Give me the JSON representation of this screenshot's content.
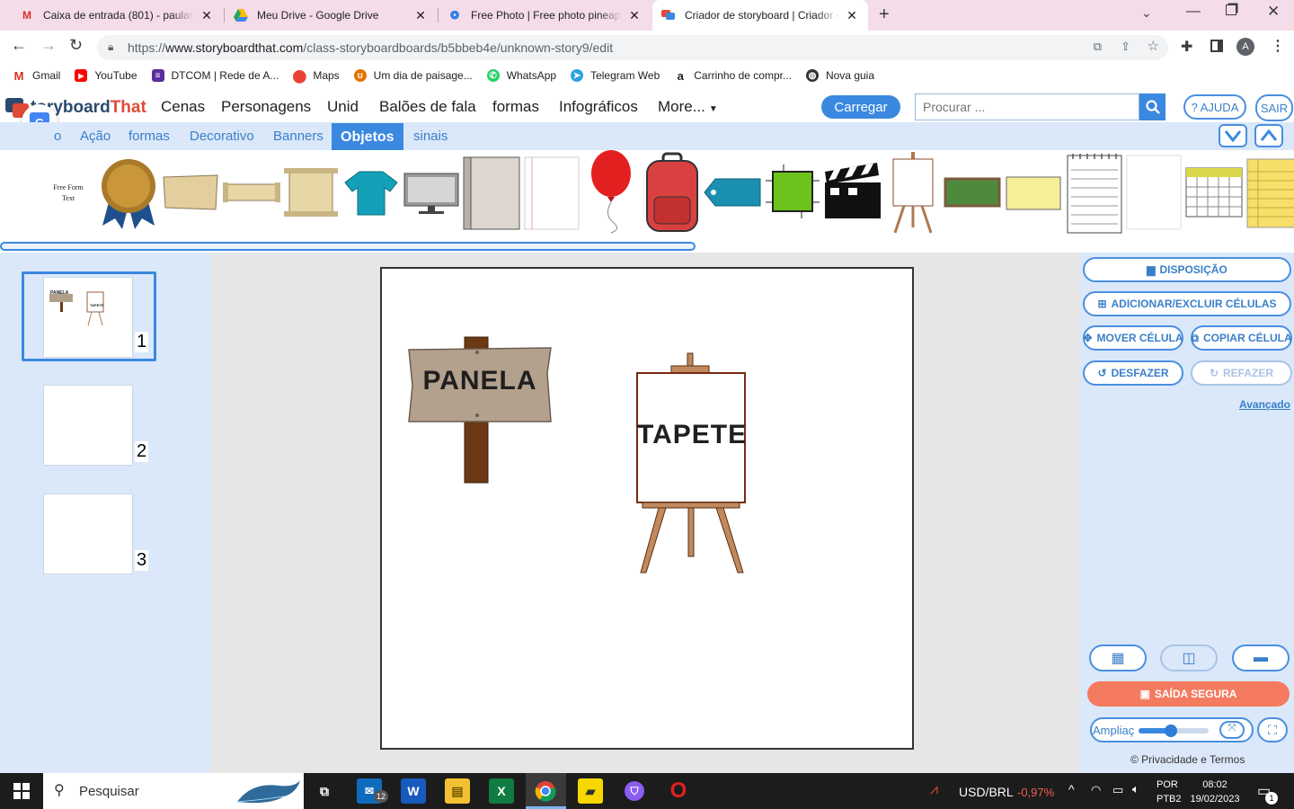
{
  "browser": {
    "tabs": [
      {
        "title": "Caixa de entrada (801) - paulario",
        "icon": "gmail-icon",
        "color": "#d93025"
      },
      {
        "title": "Meu Drive - Google Drive",
        "icon": "drive-icon",
        "color": "#1fa463"
      },
      {
        "title": "Free Photo | Free photo pineappl",
        "icon": "freepik-icon",
        "color": "#1273eb"
      },
      {
        "title": "Criador de storyboard | Criador d",
        "icon": "storyboardthat-icon",
        "color": "#e04b37"
      }
    ],
    "new_tab": "+",
    "url_prefix": "https://",
    "url_host": "www.storyboardthat.com",
    "url_path": "/class-storyboardboards/b5bbeb4e/unknown-story9/edit",
    "profile_initial": "A",
    "bookmarks": [
      {
        "label": "Gmail",
        "icon": "gmail-icon",
        "color": "#d93025"
      },
      {
        "label": "YouTube",
        "icon": "youtube-icon",
        "color": "#ff0000"
      },
      {
        "label": "DTCOM | Rede de A...",
        "icon": "dtcom-icon",
        "color": "#5b2c9e"
      },
      {
        "label": "Maps",
        "icon": "maps-icon",
        "color": "#34a853"
      },
      {
        "label": "Um dia de paisage...",
        "icon": "paisagem-icon",
        "color": "#e37400"
      },
      {
        "label": "WhatsApp",
        "icon": "whatsapp-icon",
        "color": "#25d366"
      },
      {
        "label": "Telegram Web",
        "icon": "telegram-icon",
        "color": "#2aa3e0"
      },
      {
        "label": "Carrinho de compr...",
        "icon": "amazon-icon",
        "color": "#222222"
      },
      {
        "label": "Nova guia",
        "icon": "globe-icon",
        "color": "#333333"
      }
    ]
  },
  "app": {
    "logo_main": "toryboard",
    "logo_accent": "That",
    "nav": [
      "Cenas",
      "Personagens",
      "Unid",
      "Balões de fala",
      "formas",
      "Infográficos",
      "More..."
    ],
    "upload": "Carregar",
    "search_placeholder": "Procurar ...",
    "help": "? AJUDA",
    "logout": "SAIR",
    "categories": [
      "o",
      "Ação",
      "formas",
      "Decorativo",
      "Banners",
      "Objetos",
      "sinais"
    ],
    "selected_category": "Objetos",
    "strip_first_label_line1": "Free Form",
    "strip_first_label_line2": "Text",
    "cells": [
      "1",
      "2",
      "3"
    ],
    "thumb_labels": [
      "PANELA",
      "TAPETE"
    ],
    "canvas": {
      "sign_text": "PANELA",
      "easel_text": "TAPETE"
    },
    "right": {
      "layout": "DISPOSIÇÃO",
      "add_remove": "ADICIONAR/EXCLUIR CÉLULAS",
      "move": "MOVER CÉLULA",
      "copy": "COPIAR CÉLULA",
      "undo": "DESFAZER",
      "redo": "REFAZER",
      "advanced": "Avançado",
      "safe_exit": "SAÍDA SEGURA",
      "zoom_label": "Ampliaç",
      "zoom_level": 0.46,
      "privacy": "© Privacidade e Termos"
    },
    "colors": {
      "accent": "#3a88e0",
      "safe_exit": "#f47b60",
      "logo_accent": "#e04b37"
    }
  },
  "taskbar": {
    "search": "Pesquisar",
    "mail_badge": "12",
    "currency": "USD/BRL",
    "change": "-0,97%",
    "lang1": "POR",
    "lang2": "PTB2",
    "time": "08:02",
    "date": "19/02/2023",
    "notif": "1"
  }
}
